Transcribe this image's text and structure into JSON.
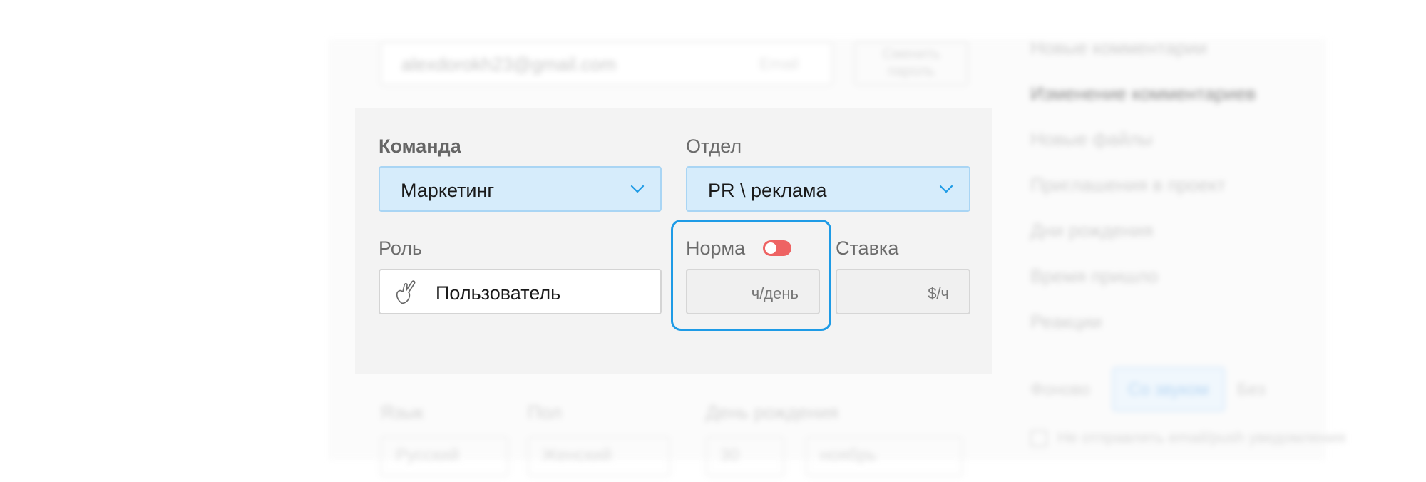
{
  "background": {
    "email": "alexdorokh23@gmail.com",
    "email_label": "Email",
    "change_password": "Сменить пароль",
    "notifications": [
      "Новые комментарии",
      "Изменение комментариев",
      "Новые файлы",
      "Приглашения в проект",
      "Дни рождения",
      "Время пришло",
      "Реакции"
    ],
    "sound_label": "Фоново",
    "sound_selected": "Со звуком",
    "sound_other": "Без",
    "checkbox_label": "Не отправлять email/push уведомления",
    "bottom": {
      "field1_label": "Язык",
      "field1_value": "Русский",
      "gender_label": "Пол",
      "gender_value": "Женский",
      "birthday_label": "День рождения",
      "day_value": "30",
      "month_value": "ноябрь"
    }
  },
  "card": {
    "team_label": "Команда",
    "team_value": "Маркетинг",
    "dept_label": "Отдел",
    "dept_value": "PR \\ реклама",
    "role_label": "Роль",
    "role_value": "Пользователь",
    "norm_label": "Норма",
    "norm_toggle_on": false,
    "norm_unit": "ч/день",
    "rate_label": "Ставка",
    "rate_unit": "$/ч"
  },
  "colors": {
    "highlight": "#1e9be6",
    "select_bg": "#d6ecfb",
    "toggle": "#ee6363",
    "card_bg": "#f3f3f3"
  }
}
